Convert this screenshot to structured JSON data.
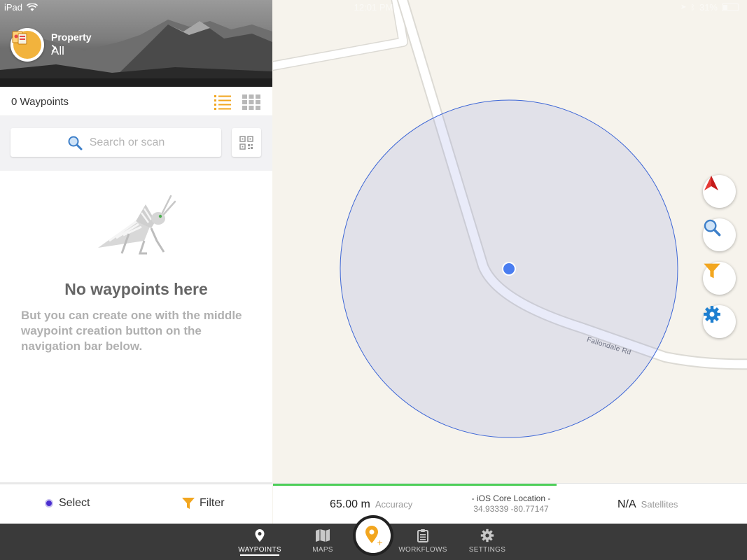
{
  "status_bar": {
    "device": "iPad",
    "time": "12:01 PM",
    "battery": "31%"
  },
  "property": {
    "label": "Property",
    "value": "All"
  },
  "waypoints": {
    "count_label": "0 Waypoints"
  },
  "search": {
    "placeholder": "Search or scan"
  },
  "empty_state": {
    "title": "No waypoints here",
    "description": "But you can create one with the middle waypoint creation button on the navigation bar below."
  },
  "left_bottom": {
    "select_label": "Select",
    "filter_label": "Filter"
  },
  "map": {
    "road_name": "Fallondale Rd"
  },
  "gps": {
    "accuracy_value": "65.00 m",
    "accuracy_label": "Accuracy",
    "source": "- iOS Core Location -",
    "coordinates": "34.93339 -80.77147",
    "satellites_value": "N/A",
    "satellites_label": "Satellites"
  },
  "tabs": [
    {
      "label": "WAYPOINTS",
      "icon": "pin-icon",
      "active": true
    },
    {
      "label": "MAPS",
      "icon": "map-icon",
      "active": false
    },
    {
      "label": "WORKFLOWS",
      "icon": "clipboard-icon",
      "active": false
    },
    {
      "label": "SETTINGS",
      "icon": "gear-icon",
      "active": false
    }
  ],
  "colors": {
    "accent": "#f2a61f",
    "location_dot": "#4a7df0",
    "accuracy_circle": "#3d66d6",
    "gps_progress": "#4fcf5a"
  }
}
